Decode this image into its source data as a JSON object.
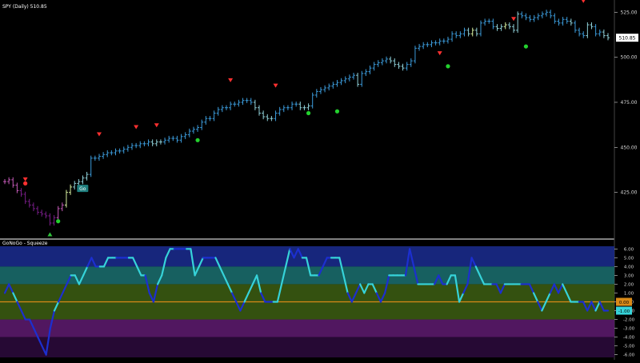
{
  "colors": {
    "background": "#000000",
    "axis_text": "#d8d8d8",
    "divider": "#ffffff",
    "go_strong": "#3b9ad9",
    "go_weak": "#8fd0d8",
    "go_start": "#d8f0a0",
    "nogo_strong": "#7a1e8a",
    "nogo_weak": "#c45ab8",
    "trend_up": "#ff3030",
    "trend_down": "#23d12e",
    "reset_green": "#2ec43a",
    "go_label_bg": "#1f7f7f",
    "osc_line": "#36d3d9",
    "osc_line_dark": "#1c2fd0",
    "osc_zero": "#d98a18",
    "zone_top": "#1a2a8a",
    "zone_mid_high": "#1a6a6a",
    "zone_mid": "#3a5a12",
    "zone_low": "#5a1a6a",
    "zone_bottom": "#2a0a3a"
  },
  "chart_data": [
    {
      "type": "candlestick",
      "title": "SPY (Daily) 510.85",
      "ylim": [
        400,
        530
      ],
      "y_ticks": [
        425.0,
        450.0,
        475.0,
        500.0,
        525.0
      ],
      "y_tick_labels": [
        "425.00",
        "450.00",
        "475.00",
        "500.00",
        "525.00"
      ],
      "last_price": "510.85",
      "go_label": "Go",
      "closes": [
        431,
        432,
        429,
        426,
        424,
        420,
        418,
        416,
        414,
        413,
        412,
        408,
        411,
        416,
        418,
        425,
        428,
        430,
        431,
        433,
        435,
        444,
        444,
        445,
        446,
        447,
        447,
        448,
        448,
        449,
        450,
        451,
        451,
        452,
        452,
        453,
        452,
        453,
        453,
        454,
        455,
        455,
        454,
        456,
        457,
        459,
        460,
        461,
        464,
        466,
        466,
        469,
        471,
        472,
        472,
        474,
        474,
        475,
        476,
        476,
        475,
        472,
        469,
        467,
        466,
        466,
        469,
        471,
        472,
        472,
        474,
        474,
        472,
        472,
        473,
        479,
        481,
        482,
        483,
        484,
        485,
        486,
        487,
        488,
        489,
        490,
        485,
        491,
        492,
        494,
        496,
        497,
        498,
        499,
        498,
        496,
        495,
        494,
        496,
        498,
        505,
        506,
        507,
        507,
        508,
        508,
        509,
        509,
        510,
        513,
        512,
        513,
        515,
        513,
        515,
        513,
        519,
        520,
        520,
        517,
        516,
        517,
        518,
        517,
        515,
        524,
        523,
        522,
        521,
        522,
        523,
        524,
        525,
        523,
        520,
        519,
        521,
        520,
        519,
        515,
        513,
        512,
        518,
        517,
        513,
        514,
        512,
        510.85
      ],
      "color_codes": [
        "nw",
        "nw",
        "nw",
        "nw",
        "ns",
        "ns",
        "ns",
        "ns",
        "ns",
        "ns",
        "ns",
        "ns",
        "ns",
        "nw",
        "nw",
        "gs",
        "gs",
        "gw",
        "gw",
        "gw",
        "gw",
        "g",
        "g",
        "g",
        "g",
        "g",
        "g",
        "g",
        "g",
        "g",
        "g",
        "g",
        "g",
        "g",
        "g",
        "g",
        "gw",
        "gw",
        "gw",
        "g",
        "g",
        "g",
        "g",
        "g",
        "g",
        "g",
        "g",
        "g",
        "g",
        "g",
        "g",
        "g",
        "g",
        "g",
        "g",
        "g",
        "g",
        "g",
        "g",
        "g",
        "g",
        "gw",
        "gw",
        "gw",
        "gw",
        "gw",
        "g",
        "g",
        "g",
        "g",
        "g",
        "g",
        "gw",
        "gw",
        "gw",
        "g",
        "g",
        "g",
        "g",
        "g",
        "g",
        "g",
        "g",
        "g",
        "g",
        "g",
        "gw",
        "g",
        "g",
        "g",
        "g",
        "g",
        "g",
        "g",
        "gw",
        "gw",
        "gw",
        "gw",
        "g",
        "g",
        "g",
        "g",
        "g",
        "g",
        "g",
        "g",
        "g",
        "g",
        "g",
        "g",
        "g",
        "g",
        "g",
        "gw",
        "gs",
        "gw",
        "g",
        "g",
        "g",
        "g",
        "gw",
        "gw",
        "gs",
        "gw",
        "gw",
        "gw",
        "g",
        "g",
        "g",
        "g",
        "g",
        "g",
        "g",
        "g",
        "g",
        "g",
        "g",
        "g",
        "gw",
        "g",
        "g",
        "g",
        "gw",
        "gw",
        "g",
        "g",
        "gw",
        "gw",
        "gw",
        "gw"
      ],
      "trend_up_markers": [
        {
          "i": 5,
          "y": 432
        },
        {
          "i": 23,
          "y": 457
        },
        {
          "i": 32,
          "y": 461
        },
        {
          "i": 37,
          "y": 462
        },
        {
          "i": 55,
          "y": 487
        },
        {
          "i": 66,
          "y": 484
        },
        {
          "i": 106,
          "y": 502
        },
        {
          "i": 124,
          "y": 521
        },
        {
          "i": 141,
          "y": 531
        }
      ],
      "trend_down_markers": [
        {
          "i": 13,
          "y": 409
        },
        {
          "i": 47,
          "y": 454
        },
        {
          "i": 74,
          "y": 469
        },
        {
          "i": 81,
          "y": 470
        },
        {
          "i": 108,
          "y": 495
        },
        {
          "i": 127,
          "y": 506
        }
      ],
      "go_marker_index": 18
    },
    {
      "type": "line",
      "title": "GoNoGo - Squeeze",
      "ylim": [
        -6.3,
        6.3
      ],
      "y_ticks": [
        6.0,
        5.0,
        4.0,
        3.0,
        2.0,
        1.0,
        0.0,
        -1.0,
        -2.0,
        -3.0,
        -4.0,
        -5.0,
        -6.0
      ],
      "y_tick_labels": [
        "6.00",
        "5.00",
        "4.00",
        "3.00",
        "2.00",
        "1.00",
        "0.00",
        "-1.00",
        "-2.00",
        "-3.00",
        "-4.00",
        "-5.00",
        "-6.00"
      ],
      "last_value": "-1.00",
      "zero_label": "0.00",
      "values": [
        1,
        2,
        1,
        0,
        -1,
        -2,
        -2,
        -3,
        -4,
        -5,
        -6,
        -3,
        -1,
        0,
        1,
        2,
        3,
        3,
        2,
        3,
        4,
        5,
        4,
        4,
        4,
        5,
        5,
        5,
        5,
        5,
        5,
        5,
        4,
        3,
        3,
        1,
        0,
        2,
        3,
        5,
        6,
        6,
        6,
        6,
        6,
        6,
        3,
        4,
        5,
        5,
        5,
        5,
        4,
        3,
        2,
        1,
        0,
        -1,
        0,
        1,
        2,
        3,
        1,
        0,
        0,
        0,
        0,
        2,
        4,
        6,
        5,
        6,
        5,
        5,
        3,
        3,
        3,
        4,
        5,
        5,
        5,
        5,
        3,
        1,
        0,
        1,
        2,
        1,
        2,
        2,
        1,
        0,
        1,
        3,
        3,
        3,
        3,
        3,
        6,
        4,
        2,
        2,
        2,
        2,
        2,
        3,
        2,
        2,
        3,
        3,
        0,
        1,
        2,
        5,
        4,
        3,
        2,
        2,
        2,
        2,
        1,
        2,
        2,
        2,
        2,
        2,
        2,
        2,
        1,
        0,
        -1,
        0,
        1,
        2,
        1,
        2,
        1,
        0,
        0,
        0,
        0,
        -1,
        0,
        -1,
        0,
        -1,
        -1
      ]
    }
  ]
}
